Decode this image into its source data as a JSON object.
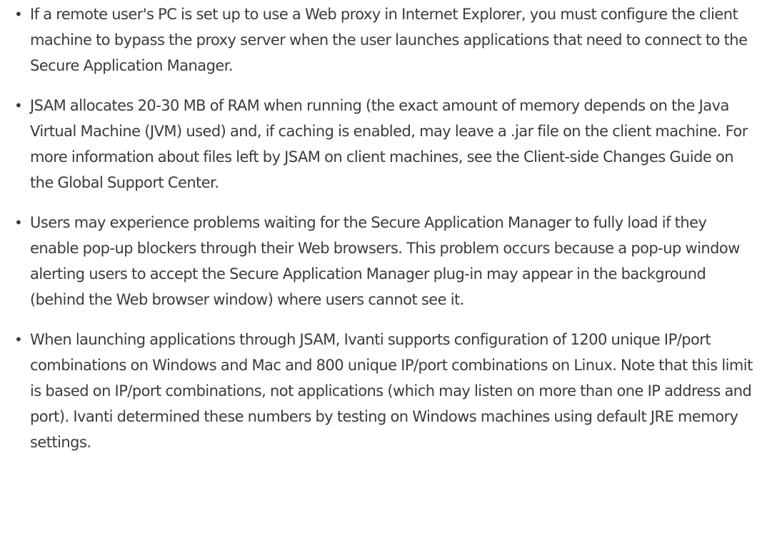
{
  "notes": {
    "items": [
      {
        "text": "If a remote user's PC is set up to use a Web proxy in Internet Explorer, you must configure the client machine to bypass the proxy server when the user launches applications that need to connect to the Secure Application Manager."
      },
      {
        "text": "JSAM allocates 20-30 MB of RAM when running (the exact amount of memory depends on the Java Virtual Machine (JVM) used) and, if caching is enabled, may leave a .jar file on the client machine. For more information about files left by JSAM on client machines, see the Client-side Changes Guide on the Global Support Center."
      },
      {
        "text": "Users may experience problems waiting for the Secure Application Manager to fully load if they enable pop-up blockers through their Web browsers. This problem occurs because a pop-up window alerting users to accept the Secure Application Manager plug-in may appear in the background (behind the Web browser window) where users cannot see it."
      },
      {
        "text": "When launching applications through JSAM, Ivanti supports configuration of 1200 unique IP/port combinations on Windows and Mac and 800 unique IP/port combinations on Linux. Note that this limit is based on IP/port combinations, not applications (which may listen on more than one IP address and port). Ivanti determined these numbers by testing on Windows machines using default JRE memory settings."
      }
    ],
    "bullet_glyph": "•"
  }
}
